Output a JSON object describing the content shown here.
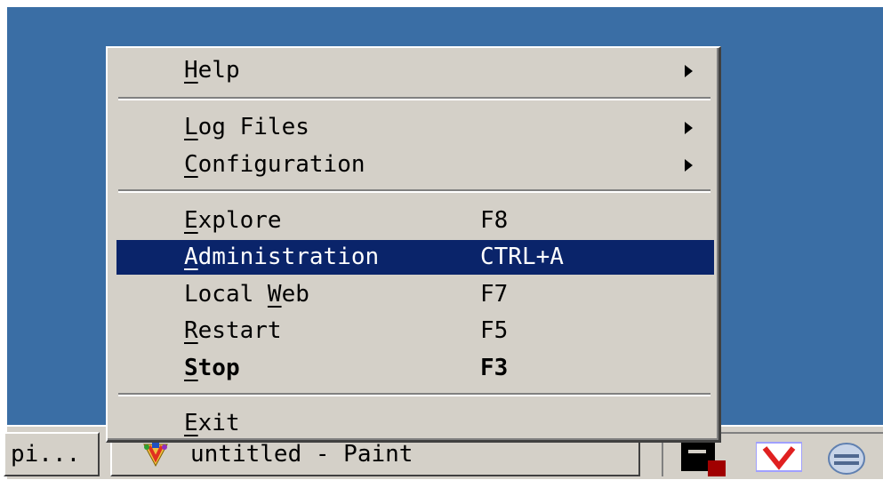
{
  "context_menu": {
    "items": [
      {
        "label_prefix": "",
        "mnemonic": "H",
        "label_suffix": "elp",
        "shortcut": "",
        "submenu": true
      },
      {
        "label_prefix": "",
        "mnemonic": "L",
        "label_suffix": "og Files",
        "shortcut": "",
        "submenu": true
      },
      {
        "label_prefix": "",
        "mnemonic": "C",
        "label_suffix": "onfiguration",
        "shortcut": "",
        "submenu": true
      },
      {
        "label_prefix": "",
        "mnemonic": "E",
        "label_suffix": "xplore",
        "shortcut": "F8",
        "submenu": false
      },
      {
        "label_prefix": "",
        "mnemonic": "A",
        "label_suffix": "dministration",
        "shortcut": "CTRL+A",
        "submenu": false,
        "highlighted": true
      },
      {
        "label_prefix": "Local ",
        "mnemonic": "W",
        "label_suffix": "eb",
        "shortcut": "F7",
        "submenu": false
      },
      {
        "label_prefix": "",
        "mnemonic": "R",
        "label_suffix": "estart",
        "shortcut": "F5",
        "submenu": false
      },
      {
        "label_prefix": "",
        "mnemonic": "S",
        "label_suffix": "top",
        "shortcut": "F3",
        "submenu": false,
        "bold": true
      },
      {
        "label_prefix": "",
        "mnemonic": "E",
        "label_suffix": "xit",
        "shortcut": "",
        "submenu": false
      }
    ]
  },
  "taskbar": {
    "buttons": [
      {
        "label": "pi..."
      },
      {
        "label": "untitled - Paint",
        "icon": "paint-icon"
      }
    ],
    "tray_icons": [
      "server-status-icon",
      "antivirus-icon",
      "messenger-icon"
    ]
  },
  "colors": {
    "desktop": "#3a6ea5",
    "menu_bg": "#d4d0c8",
    "highlight": "#0a246a"
  }
}
